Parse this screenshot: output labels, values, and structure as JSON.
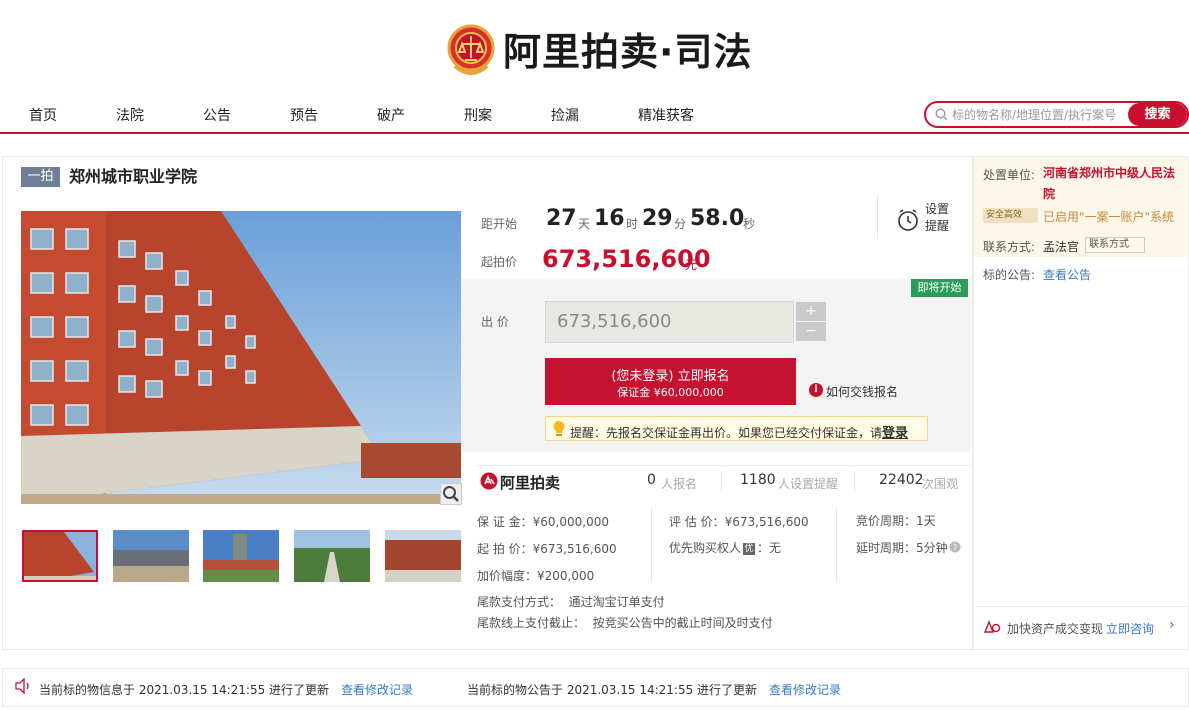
{
  "brand": {
    "name": "阿里拍卖·司法"
  },
  "nav": {
    "items": [
      "首页",
      "法院",
      "公告",
      "预告",
      "破产",
      "刑案",
      "捡漏",
      "精准获客"
    ]
  },
  "search": {
    "placeholder": "标的物名称/地理位置/执行案号",
    "button": "搜索"
  },
  "lot": {
    "badge": "一拍",
    "title": "郑州城市职业学院"
  },
  "countdown": {
    "label": "距开始",
    "days": "27",
    "days_unit": "天",
    "hours": "16",
    "hours_unit": "时",
    "minutes": "29",
    "minutes_unit": "分",
    "seconds": "58.0",
    "seconds_unit": "秒"
  },
  "reminder": {
    "label": "设置提醒"
  },
  "start_price": {
    "label": "起拍价",
    "value": "673,516,600",
    "unit": "元"
  },
  "bid": {
    "status_badge": "即将开始",
    "label": "出 价",
    "value": "673,516,600",
    "plus": "+",
    "minus": "−",
    "register_line1": "(您未登录) 立即报名",
    "register_line2": "保证金 ¥60,000,000",
    "how_pay": "如何交钱报名",
    "tip_text": "提醒：先报名交保证金再出价。如果您已经交付保证金，请",
    "tip_login": "登录"
  },
  "stats": {
    "logo": "阿里拍卖",
    "signups": "0",
    "signups_unit": "人报名",
    "reminders": "1180",
    "reminders_unit": "人设置提醒",
    "views": "22402",
    "views_unit": "次围观"
  },
  "info": {
    "deposit": "保 证 金：¥60,000,000",
    "start_price": "起 拍 价：¥673,516,600",
    "increment": "加价幅度：¥200,000",
    "appraisal": "评 估 价：¥673,516,600",
    "priority": "优先购买权人",
    "priority_badge": "优",
    "priority_value": "：无",
    "cycle": "竞价周期：1天",
    "extension": "延时周期：5分钟",
    "payment_method_label": "尾款支付方式：",
    "payment_method": "通过淘宝订单支付",
    "payment_deadline_label": "尾款线上支付截止：",
    "payment_deadline": "按竞买公告中的截止时间及时支付"
  },
  "side": {
    "unit_label": "处置单位:",
    "unit_value": "河南省郑州市中级人民法院",
    "safety_badge": "安全高效",
    "safety_text": "已启用\"一案一账户\"系统",
    "contact_label": "联系方式:",
    "contact_value": "孟法官",
    "contact_btn": "联系方式",
    "notice_label": "标的公告:",
    "notice_link": "查看公告",
    "promo_text": "加快资产成交变现",
    "promo_link": "立即咨询",
    "promo_arrow": "›"
  },
  "footer": {
    "info_update": "当前标的物信息于 2021.03.15 14:21:55 进行了更新",
    "info_link": "查看修改记录",
    "notice_update": "当前标的物公告于 2021.03.15 14:21:55 进行了更新",
    "notice_link": "查看修改记录"
  },
  "colors": {
    "accent": "#c8102e",
    "link": "#3a78c8",
    "success": "#2a9d57"
  }
}
